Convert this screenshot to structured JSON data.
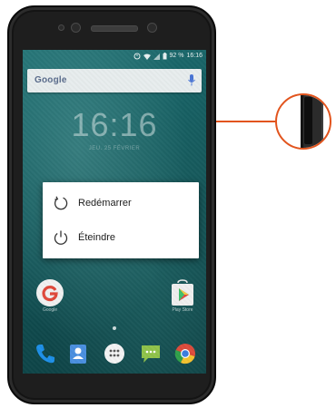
{
  "status_bar": {
    "left_indicator": "",
    "battery_text": "92 %",
    "time": "16:16"
  },
  "search": {
    "brand_text": "Google",
    "icons": {
      "mic": "mic-icon"
    }
  },
  "lock_clock": {
    "time": "16:16",
    "date": "JEU. 25 FÉVRIER"
  },
  "power_menu": {
    "items": [
      {
        "label": "Redémarrer",
        "icon": "restart-icon"
      },
      {
        "label": "Éteindre",
        "icon": "power-icon"
      }
    ]
  },
  "home_apps": [
    {
      "label": "Google",
      "icon": "google-icon"
    },
    {
      "label": "Play Store",
      "icon": "play-store-icon"
    }
  ],
  "dock": [
    {
      "icon": "phone-icon"
    },
    {
      "icon": "contacts-icon"
    },
    {
      "icon": "app-drawer-icon"
    },
    {
      "icon": "messages-icon"
    },
    {
      "icon": "chrome-icon"
    }
  ],
  "colors": {
    "accent": "#e2541d",
    "wallpaper": "#145a5d",
    "dialog_bg": "#ffffff"
  }
}
